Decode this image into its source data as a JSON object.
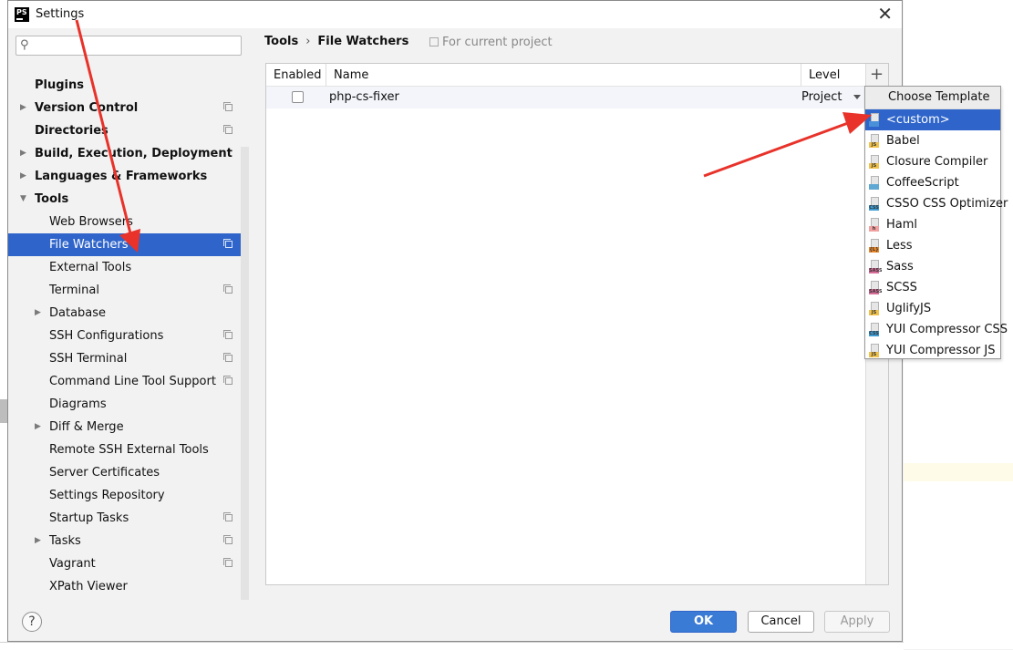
{
  "window": {
    "title": "Settings",
    "app_icon_text": "PS"
  },
  "search": {
    "placeholder": ""
  },
  "tree": [
    {
      "label": "Plugins",
      "bold": true,
      "arrow": "",
      "copy": false
    },
    {
      "label": "Version Control",
      "bold": true,
      "arrow": "▶",
      "copy": true
    },
    {
      "label": "Directories",
      "bold": true,
      "arrow": "",
      "copy": true
    },
    {
      "label": "Build, Execution, Deployment",
      "bold": true,
      "arrow": "▶",
      "copy": false
    },
    {
      "label": "Languages & Frameworks",
      "bold": true,
      "arrow": "▶",
      "copy": false
    },
    {
      "label": "Tools",
      "bold": true,
      "arrow": "▼",
      "copy": false
    },
    {
      "label": "Web Browsers",
      "bold": false,
      "arrow": "",
      "copy": false
    },
    {
      "label": "File Watchers",
      "bold": false,
      "arrow": "",
      "copy": true,
      "selected": true
    },
    {
      "label": "External Tools",
      "bold": false,
      "arrow": "",
      "copy": false
    },
    {
      "label": "Terminal",
      "bold": false,
      "arrow": "",
      "copy": true
    },
    {
      "label": "Database",
      "bold": false,
      "arrow": "▶",
      "copy": false
    },
    {
      "label": "SSH Configurations",
      "bold": false,
      "arrow": "",
      "copy": true
    },
    {
      "label": "SSH Terminal",
      "bold": false,
      "arrow": "",
      "copy": true
    },
    {
      "label": "Command Line Tool Support",
      "bold": false,
      "arrow": "",
      "copy": true
    },
    {
      "label": "Diagrams",
      "bold": false,
      "arrow": "",
      "copy": false
    },
    {
      "label": "Diff & Merge",
      "bold": false,
      "arrow": "▶",
      "copy": false
    },
    {
      "label": "Remote SSH External Tools",
      "bold": false,
      "arrow": "",
      "copy": false
    },
    {
      "label": "Server Certificates",
      "bold": false,
      "arrow": "",
      "copy": false
    },
    {
      "label": "Settings Repository",
      "bold": false,
      "arrow": "",
      "copy": false
    },
    {
      "label": "Startup Tasks",
      "bold": false,
      "arrow": "",
      "copy": true
    },
    {
      "label": "Tasks",
      "bold": false,
      "arrow": "▶",
      "copy": true
    },
    {
      "label": "Vagrant",
      "bold": false,
      "arrow": "",
      "copy": true
    },
    {
      "label": "XPath Viewer",
      "bold": false,
      "arrow": "",
      "copy": false
    }
  ],
  "breadcrumb": {
    "parent": "Tools",
    "separator": "›",
    "current": "File Watchers"
  },
  "scope_note": "For current project",
  "table": {
    "headers": {
      "enabled": "Enabled",
      "name": "Name",
      "level": "Level"
    },
    "rows": [
      {
        "enabled": false,
        "name": "php-cs-fixer",
        "level": "Project"
      }
    ],
    "add_button": "+"
  },
  "popup": {
    "title": "Choose Template",
    "items": [
      {
        "label": "<custom>",
        "icon": "custom-file-icon",
        "tag": "",
        "tag_color": "#4a90d9",
        "selected": true
      },
      {
        "label": "Babel",
        "icon": "js-file-icon",
        "tag": "JS",
        "tag_color": "#f0c24b"
      },
      {
        "label": "Closure Compiler",
        "icon": "js-file-icon",
        "tag": "JS",
        "tag_color": "#f0c24b"
      },
      {
        "label": "CoffeeScript",
        "icon": "coffeescript-file-icon",
        "tag": "",
        "tag_color": "#5fa8d3"
      },
      {
        "label": "CSSO CSS Optimizer",
        "icon": "css-file-icon",
        "tag": "CSS",
        "tag_color": "#3c9ad1"
      },
      {
        "label": "Haml",
        "icon": "haml-file-icon",
        "tag": "h",
        "tag_color": "#f2a0a0"
      },
      {
        "label": "Less",
        "icon": "less-file-icon",
        "tag": "{L}",
        "tag_color": "#e8862a"
      },
      {
        "label": "Sass",
        "icon": "sass-file-icon",
        "tag": "SASS",
        "tag_color": "#d86c98"
      },
      {
        "label": "SCSS",
        "icon": "scss-file-icon",
        "tag": "SASS",
        "tag_color": "#d86c98"
      },
      {
        "label": "UglifyJS",
        "icon": "js-file-icon",
        "tag": "JS",
        "tag_color": "#f0c24b"
      },
      {
        "label": "YUI Compressor CSS",
        "icon": "css-file-icon",
        "tag": "CSS",
        "tag_color": "#3c9ad1"
      },
      {
        "label": "YUI Compressor JS",
        "icon": "js-file-icon",
        "tag": "JS",
        "tag_color": "#f0c24b"
      }
    ]
  },
  "footer": {
    "help": "?",
    "ok": "OK",
    "cancel": "Cancel",
    "apply": "Apply"
  },
  "colors": {
    "selection": "#2f65ca",
    "annotation_arrow": "#e8322a"
  }
}
